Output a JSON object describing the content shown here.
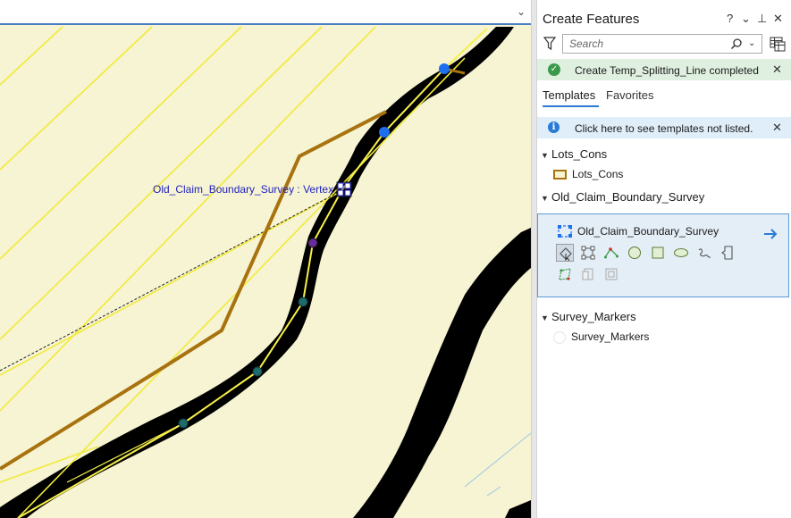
{
  "pane": {
    "title": "Create Features",
    "header_buttons": {
      "help": "?",
      "menu": "⌄",
      "pin": "⊥",
      "close": "✕"
    },
    "search": {
      "placeholder": "Search",
      "value": ""
    },
    "success_message": "Create Temp_Splitting_Line completed",
    "tabs": [
      {
        "label": "Templates",
        "active": true
      },
      {
        "label": "Favorites",
        "active": false
      }
    ],
    "info_message": "Click here to see templates not listed.",
    "groups": [
      {
        "name": "Lots_Cons",
        "templates": [
          {
            "label": "Lots_Cons",
            "symbol": "brown-outline-rectangle"
          }
        ]
      },
      {
        "name": "Old_Claim_Boundary_Survey",
        "templates": [
          {
            "label": "Old_Claim_Boundary_Survey",
            "selected": true
          }
        ]
      },
      {
        "name": "Survey_Markers",
        "templates": [
          {
            "label": "Survey_Markers",
            "symbol": "white-circle"
          }
        ]
      }
    ],
    "tools": [
      "select-tool",
      "edit-vertices-tool",
      "polyline-tool",
      "circle-tool",
      "rectangle-tool",
      "ellipse-tool",
      "freehand-tool",
      "trace-tool",
      "right-angle-tool",
      "clone-tool",
      "copy-tool"
    ]
  },
  "map": {
    "vertex_label": "Old_Claim_Boundary_Survey : Vertex",
    "colors": {
      "background": "#f6f4d2",
      "parcel_line": "#f2ea3a",
      "boundary": "#a8720f",
      "river": "#000000",
      "vertex_blue": "#1e6ef0"
    }
  }
}
